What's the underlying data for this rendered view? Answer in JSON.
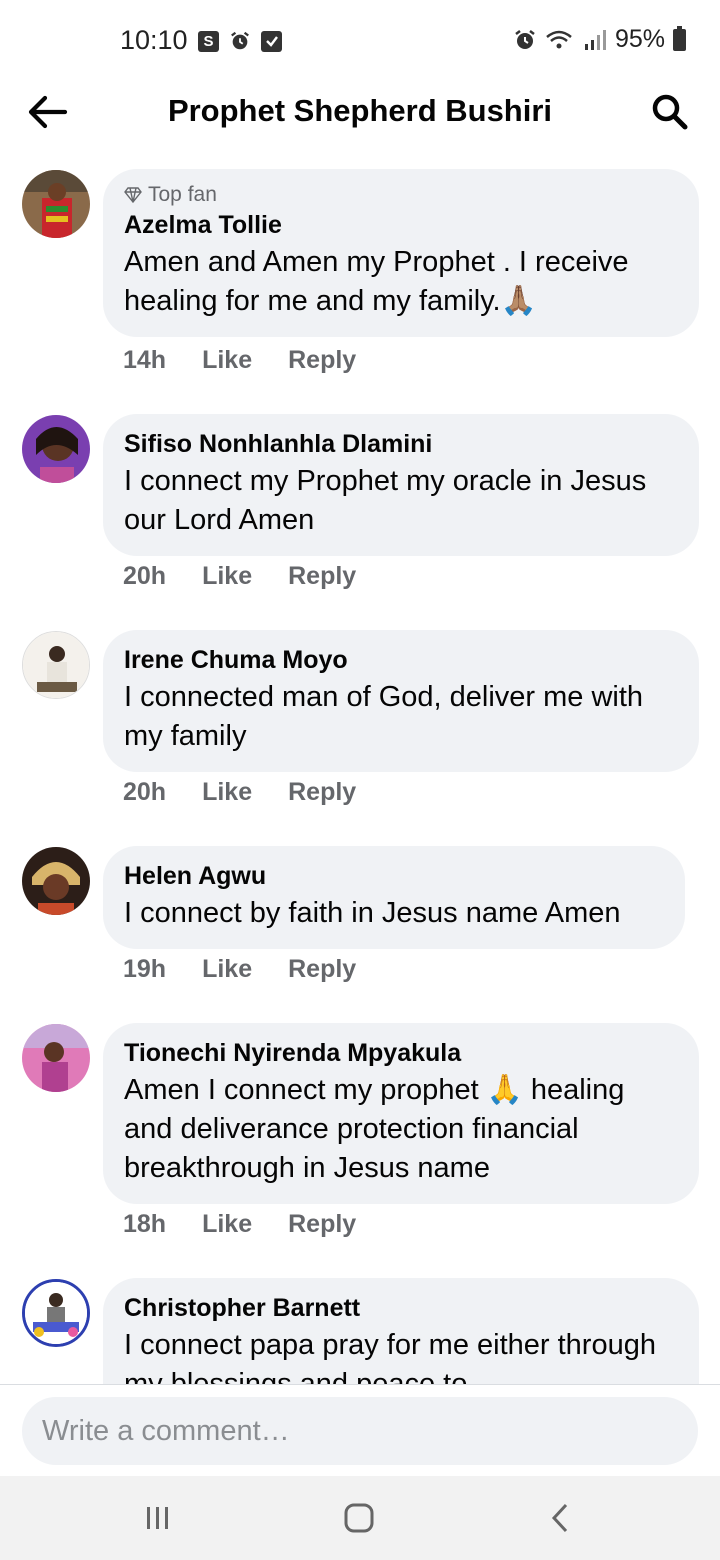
{
  "status_bar": {
    "time": "10:10",
    "battery": "95%",
    "icons": [
      "s-app-icon",
      "alarm-icon",
      "check-icon",
      "alarm-icon",
      "wifi-icon",
      "signal-icon",
      "battery-icon"
    ]
  },
  "header": {
    "title": "Prophet Shepherd Bushiri",
    "back_icon": "arrow-left-icon",
    "search_icon": "search-icon"
  },
  "comments": [
    {
      "badge": "Top fan",
      "author": "Azelma Tollie",
      "text": "Amen and Amen my Prophet . I receive healing for me and my family.🙏🏽",
      "time": "14h",
      "like": "Like",
      "reply": "Reply"
    },
    {
      "author": "Sifiso Nonhlanhla Dlamini",
      "text": "I connect my Prophet my oracle in Jesus our Lord Amen",
      "time": "20h",
      "like": "Like",
      "reply": "Reply"
    },
    {
      "author": "Irene Chuma Moyo",
      "text": "I connected man of God, deliver me with my family",
      "time": "20h",
      "like": "Like",
      "reply": "Reply"
    },
    {
      "author": "Helen Agwu",
      "text": "I connect by faith in Jesus name Amen",
      "time": "19h",
      "like": "Like",
      "reply": "Reply"
    },
    {
      "author": "Tionechi Nyirenda Mpyakula",
      "text": "Amen I connect my prophet 🙏 healing and deliverance protection financial breakthrough in Jesus name",
      "time": "18h",
      "like": "Like",
      "reply": "Reply"
    },
    {
      "author": "Christopher Barnett",
      "text": "I connect papa pray for me either through my blessings and peace to",
      "time": "",
      "like": "",
      "reply": ""
    }
  ],
  "composer": {
    "placeholder": "Write a comment…"
  },
  "nav": {
    "recents_icon": "recents-icon",
    "home_icon": "home-icon",
    "back_icon": "back-chevron-icon"
  },
  "colors": {
    "bubble": "#f0f2f5",
    "secondary_text": "#65676b",
    "primary_text": "#050505"
  }
}
